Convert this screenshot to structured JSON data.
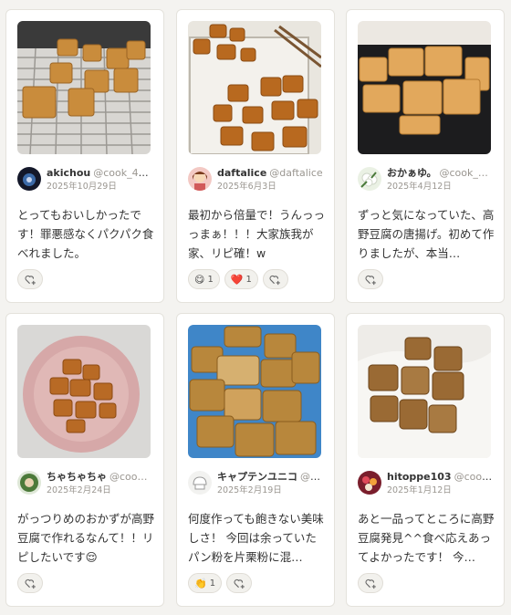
{
  "cards": [
    {
      "name": "akichou",
      "handle": "@cook_40…",
      "date": "2025年10月29日",
      "comment": "とってもおいしかったです！罪悪感なくパクパク食べれました。",
      "reactions": []
    },
    {
      "name": "daftalice",
      "handle": "@daftalice",
      "date": "2025年6月3日",
      "comment": "最初から倍量で！うんっっっまぁ！！！大家族我が家、リピ確！w",
      "reactions": [
        {
          "emoji": "😋",
          "count": "1"
        },
        {
          "emoji": "❤️",
          "count": "1"
        }
      ]
    },
    {
      "name": "おかぁゆ。",
      "handle": "@cook_…",
      "date": "2025年4月12日",
      "comment": "ずっと気になっていた、高野豆腐の唐揚げ。初めて作りましたが、本当…",
      "reactions": []
    },
    {
      "name": "ちゃちゃちゃ",
      "handle": "@coo…",
      "date": "2025年2月24日",
      "comment": "がっつりめのおかずが高野豆腐で作れるなんて！！リピしたいです😌",
      "reactions": []
    },
    {
      "name": "キャプテンユニコ",
      "handle": "@c…",
      "date": "2025年2月19日",
      "comment": "何度作っても飽きない美味しさ！ 今回は余っていたパン粉を片栗粉に混…",
      "reactions": [
        {
          "emoji": "👏",
          "count": "1"
        }
      ]
    },
    {
      "name": "hitoppe103",
      "handle": "@cook_…",
      "date": "2025年1月12日",
      "comment": "あと一品ってところに高野豆腐発見^^食べ応えあってよかったです！ 今…",
      "reactions": []
    }
  ]
}
